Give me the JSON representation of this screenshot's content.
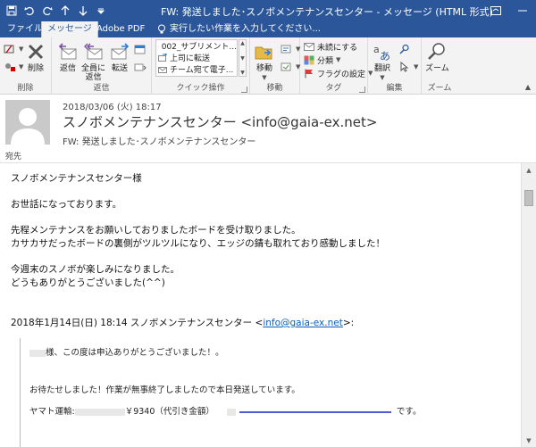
{
  "window": {
    "title": "FW: 発送しました･スノボメンテナンスセンター - メッセージ (HTML 形式)"
  },
  "tabs": [
    {
      "label": "ファイル"
    },
    {
      "label": "メッセージ"
    },
    {
      "label": "Adobe PDF"
    }
  ],
  "tell_me": "実行したい作業を入力してください...",
  "ribbon": {
    "delete_group": {
      "label": "削除",
      "delete_button": "削除"
    },
    "respond_group": {
      "label": "返信",
      "reply": "返信",
      "reply_all": "全員に\n返信",
      "forward": "転送"
    },
    "quick_steps": {
      "label": "クイック操作",
      "items": [
        "002_サブリメント...",
        "上司に転送",
        "チーム宛て電子..."
      ]
    },
    "move_group": {
      "label": "移動",
      "move": "移動"
    },
    "tags_group": {
      "label": "タグ",
      "unread": "未読にする",
      "categorize": "分類",
      "follow_up": "フラグの設定"
    },
    "editing_group": {
      "label": "編集",
      "translate": "翻訳"
    },
    "zoom_group": {
      "label": "ズーム",
      "zoom": "ズーム"
    }
  },
  "message": {
    "date": "2018/03/06 (火) 18:17",
    "from": "スノボメンテナンスセンター <info@gaia-ex.net>",
    "subject": "FW: 発送しました･スノボメンテナンスセンター",
    "to_label": "宛先",
    "body": {
      "line1": "スノボメンテナンスセンター様",
      "line2": "お世話になっております。",
      "line3": "先程メンテナンスをお願いしておりましたボードを受け取りました。",
      "line4": "カサカサだったボードの裏側がツルツルになり、エッジの錆も取れており感動しました！",
      "line5": "今週末のスノボが楽しみになりました。",
      "line6": "どうもありがとうございました(^^)",
      "forward_header_prefix": "2018年1月14日(日) 18:14 スノボメンテナンスセンター <",
      "forward_header_email": "info@gaia-ex.net",
      "forward_header_suffix": ">:",
      "quote1": "様、この度は申込ありがとうございました！。",
      "quote2": "お待たせしました！作業が無事終了しましたので本日発送しています。",
      "quote3_a": "ヤマト運輸:",
      "quote3_b": "￥9340（代引き金額）",
      "quote3_c": "です。"
    }
  },
  "colors": {
    "title_bar": "#2b579a",
    "ribbon_bg": "#f3f3f3",
    "link": "#0563c1"
  }
}
